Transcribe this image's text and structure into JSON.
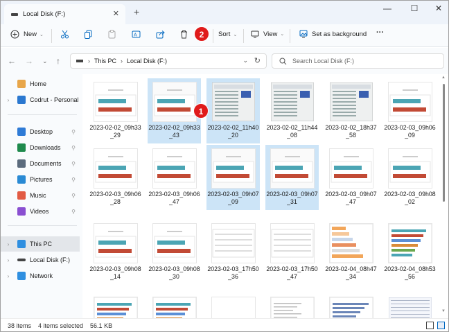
{
  "window": {
    "tab_title": "Local Disk (F:)",
    "tab_close": "✕",
    "new_tab": "+",
    "minimize": "—",
    "maximize": "☐",
    "close": "✕"
  },
  "toolbar": {
    "new_label": "New",
    "sort_label": "Sort",
    "view_label": "View",
    "background_label": "Set as background",
    "more_label": "···"
  },
  "badges": [
    "1",
    "2"
  ],
  "address": {
    "crumbs": [
      "This PC",
      "Local Disk (F:)"
    ],
    "separator": "›",
    "search_placeholder": "Search Local Disk (F:)"
  },
  "sidebar": {
    "items": [
      {
        "label": "Home",
        "icon": "home-icon",
        "color": "#e8a64a"
      },
      {
        "label": "Codrut - Personal",
        "icon": "cloud-icon",
        "color": "#2b78d0"
      },
      {
        "label": "Desktop",
        "icon": "desktop-icon",
        "color": "#2f7bd6"
      },
      {
        "label": "Downloads",
        "icon": "download-icon",
        "color": "#1f8a4d"
      },
      {
        "label": "Documents",
        "icon": "document-icon",
        "color": "#5b6b7d"
      },
      {
        "label": "Pictures",
        "icon": "picture-icon",
        "color": "#2a8ad4"
      },
      {
        "label": "Music",
        "icon": "music-icon",
        "color": "#e25b44"
      },
      {
        "label": "Videos",
        "icon": "video-icon",
        "color": "#8a4fd1"
      },
      {
        "label": "This PC",
        "icon": "pc-icon",
        "color": "#2f8fe0"
      },
      {
        "label": "Local Disk (F:)",
        "icon": "drive-icon",
        "color": "#444444"
      },
      {
        "label": "Network",
        "icon": "network-icon",
        "color": "#2f8fe0"
      }
    ],
    "pin_glyph": "📌"
  },
  "files": [
    {
      "name": "2023-02-02_09h33_29",
      "type": "bars"
    },
    {
      "name": "2023-02-02_09h33_43",
      "type": "bars"
    },
    {
      "name": "2023-02-02_11h40_20",
      "type": "cpuz"
    },
    {
      "name": "2023-02-02_11h44_08",
      "type": "cpuz"
    },
    {
      "name": "2023-02-02_18h37_58",
      "type": "cpuz"
    },
    {
      "name": "2023-02-03_09h06_09",
      "type": "bars"
    },
    {
      "name": "2023-02-03_09h06_28",
      "type": "bars"
    },
    {
      "name": "2023-02-03_09h06_47",
      "type": "bars"
    },
    {
      "name": "2023-02-03_09h07_09",
      "type": "bars"
    },
    {
      "name": "2023-02-03_09h07_31",
      "type": "bars"
    },
    {
      "name": "2023-02-03_09h07_47",
      "type": "bars"
    },
    {
      "name": "2023-02-03_09h08_02",
      "type": "bars"
    },
    {
      "name": "2023-02-03_09h08_14",
      "type": "bars"
    },
    {
      "name": "2023-02-03_09h08_30",
      "type": "bars"
    },
    {
      "name": "2023-02-03_17h50_36",
      "type": "table"
    },
    {
      "name": "2023-02-03_17h50_47",
      "type": "table"
    },
    {
      "name": "2023-02-04_08h47_34",
      "type": "colorful"
    },
    {
      "name": "2023-02-04_08h53_56",
      "type": "multibars"
    },
    {
      "name": "",
      "type": "multibars"
    },
    {
      "name": "",
      "type": "multibars"
    },
    {
      "name": "",
      "type": "blank"
    },
    {
      "name": "",
      "type": "textdoc"
    },
    {
      "name": "",
      "type": "hbars"
    },
    {
      "name": "",
      "type": "screenshot"
    }
  ],
  "selected_indices": [
    1,
    2,
    8,
    9
  ],
  "status": {
    "items_count": "38 items",
    "selected": "4 items selected",
    "size": "56.1 KB"
  },
  "colors": {
    "accent": "#0067c0",
    "selection": "#cce4f7",
    "bar_teal": "#4ba5b4",
    "bar_red": "#c24a35",
    "badge": "#e01b1b"
  }
}
